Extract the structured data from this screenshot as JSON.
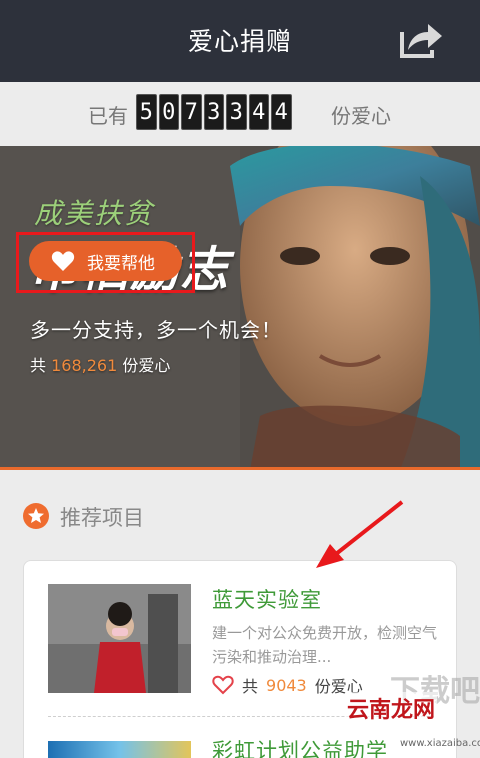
{
  "header": {
    "title": "爱心捐赠"
  },
  "counter": {
    "prefix": "已有",
    "digits": [
      "5",
      "0",
      "7",
      "3",
      "3",
      "4",
      "4"
    ],
    "suffix": "份爱心"
  },
  "banner": {
    "calligraphy_line1": "成美扶贫",
    "calligraphy_line2": "巾帼励志",
    "slogan": "多一分支持，多一个机会！",
    "total_prefix": "共",
    "total_value": "168,261",
    "total_suffix": "份爱心",
    "help_button": "我要帮他"
  },
  "section": {
    "title": "推荐项目"
  },
  "projects": [
    {
      "title": "蓝天实验室",
      "desc": "建一个对公众免费开放，检测空气污染和推动治理...",
      "love_prefix": "共",
      "love_count": "9043",
      "love_suffix": "份爱心"
    },
    {
      "title": "彩虹计划公益助学"
    }
  ],
  "watermark": {
    "brand": "云南龙网",
    "faded": "下载吧",
    "url": "www.xiazaiba.com"
  },
  "colors": {
    "header_bg": "#2d313b",
    "accent": "#e6612a",
    "title_green": "#3f9a38",
    "highlight_red": "#e8191c"
  },
  "icons": {
    "share": "share-icon",
    "heart": "heart-icon",
    "section": "star-icon"
  }
}
